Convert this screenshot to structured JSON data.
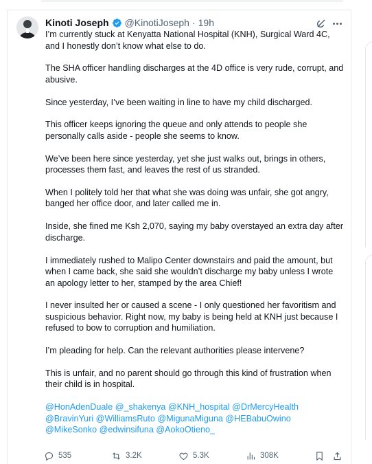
{
  "tweet": {
    "author_name": "Kinoti Joseph",
    "handle": "@KinotiJoseph",
    "separator": "·",
    "time": "19h",
    "paragraphs": [
      "I’m currently stuck at Kenyatta National Hospital (KNH), Surgical Ward 4C, and I honestly don’t know what else to do.",
      "The SHA officer handling discharges at the 4D office is very rude, corrupt, and abusive.",
      "Since yesterday, I’ve been waiting in line to have my child discharged.",
      "This officer keeps ignoring the queue and only attends to people she personally calls aside - people she seems to know.",
      "We’ve been here since yesterday, yet she just walks out, brings in others, processes them fast, and leaves the rest of us stranded.",
      "When I politely told her that what she was doing was unfair, she got angry, banged her office door, and later called me in.",
      "Inside, she fined me Ksh 2,070, saying my baby overstayed an extra day after discharge.",
      "I immediately rushed to Malipo Center downstairs and paid the amount, but when I came back, she said she wouldn’t discharge my baby unless I wrote an apology letter to her, stamped by the area Chief!",
      "I never insulted her or caused a scene - I only questioned her favoritism and suspicious behavior. Right now, my baby is being held at KNH just because I refused to bow to corruption and humiliation.",
      "I’m pleading for help. Can the relevant authorities please intervene?",
      "This is unfair, and no parent should go through this kind of frustration when their child is in hospital."
    ],
    "mentions": "@HonAdenDuale @_shakenya @KNH_hospital @DrMercyHealth @BravinYuri @WilliamsRuto @MigunaMiguna @HEBabuOwino @MikeSonko @edwinsifuna @AokoOtieno_"
  },
  "actions": {
    "replies": "535",
    "reposts": "3.2K",
    "likes": "5.3K",
    "views": "308K"
  },
  "icons": {
    "verified": "verified-badge-icon",
    "grok": "grok-icon",
    "more": "more-icon",
    "reply": "reply-icon",
    "repost": "repost-icon",
    "like": "heart-icon",
    "views": "views-icon",
    "bookmark": "bookmark-icon",
    "share": "share-icon"
  },
  "colors": {
    "accent": "#1d9bf0",
    "text": "#0f1419",
    "muted": "#536471"
  }
}
